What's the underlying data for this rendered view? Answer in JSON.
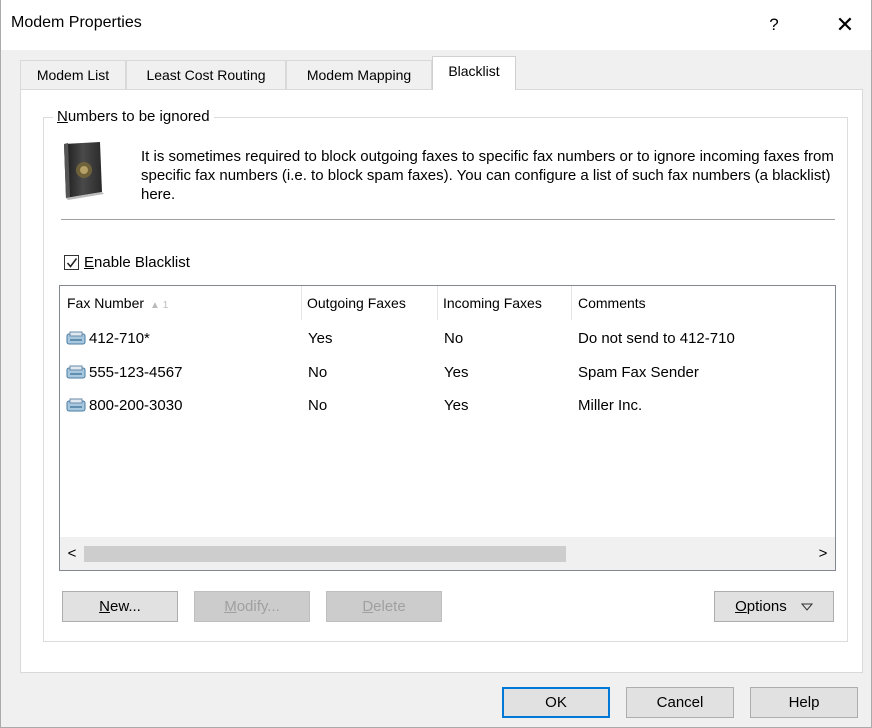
{
  "window": {
    "title": "Modem Properties",
    "help_glyph": "?",
    "close_glyph": "✕"
  },
  "tabs": [
    {
      "label": "Modem List"
    },
    {
      "label": "Least Cost Routing"
    },
    {
      "label": "Modem Mapping"
    },
    {
      "label": "Blacklist",
      "active": true
    }
  ],
  "group": {
    "label_first": "N",
    "label_rest": "umbers to be ignored",
    "icon": "book-icon",
    "description": "It is sometimes required to block outgoing faxes to specific fax numbers or to ignore incoming faxes from specific fax numbers (i.e. to block spam faxes). You can configure a list of such fax numbers (a blacklist) here."
  },
  "enable_blacklist": {
    "checked": true,
    "label_first": "E",
    "label_rest": "nable Blacklist"
  },
  "table": {
    "columns": [
      "Fax Number",
      "Outgoing Faxes",
      "Incoming Faxes",
      "Comments"
    ],
    "sort_indicator": "▲ 1",
    "rows": [
      {
        "fax": "412-710*",
        "outgoing": "Yes",
        "incoming": "No",
        "comment": "Do not send to 412-710"
      },
      {
        "fax": "555-123-4567",
        "outgoing": "No",
        "incoming": "Yes",
        "comment": "Spam Fax Sender"
      },
      {
        "fax": "800-200-3030",
        "outgoing": "No",
        "incoming": "Yes",
        "comment": "Miller Inc."
      }
    ],
    "scroll_left": "<",
    "scroll_right": ">"
  },
  "buttons": {
    "new_first": "N",
    "new_rest": "ew...",
    "modify_first": "M",
    "modify_rest": "odify...",
    "delete_first": "D",
    "delete_rest": "elete",
    "options_first": "O",
    "options_rest": "ptions",
    "ok": "OK",
    "cancel": "Cancel",
    "help": "Help"
  },
  "colors": {
    "accent": "#0078d7",
    "dialog_bg": "#f0f0f0"
  }
}
